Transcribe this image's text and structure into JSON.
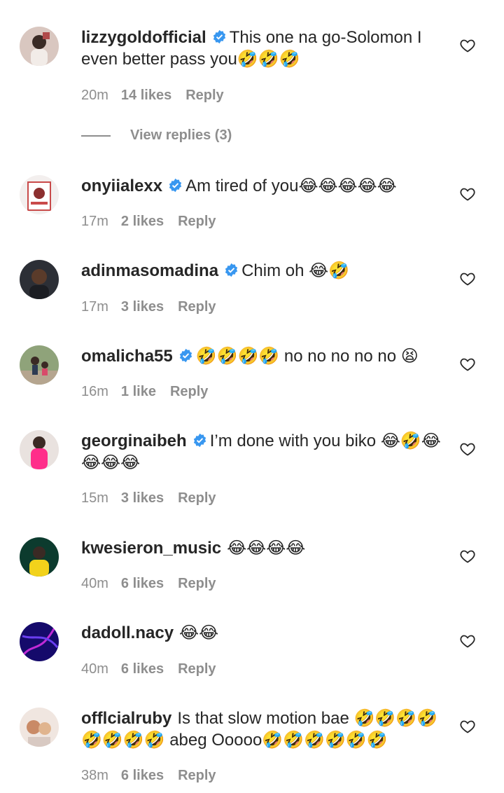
{
  "view_replies_label": "View replies (3)",
  "colors": {
    "accent": "#3897f0",
    "muted": "#8e8e8e",
    "text": "#262626"
  },
  "comments": [
    {
      "username": "lizzygoldofficial",
      "verified": true,
      "text": "This one na go-Solomon I even better pass you🤣🤣🤣",
      "time": "20m",
      "likes": "14 likes",
      "reply": "Reply"
    },
    {
      "username": "onyiialexx",
      "verified": true,
      "text": "Am tired of you😂😂😂😂😂",
      "time": "17m",
      "likes": "2 likes",
      "reply": "Reply"
    },
    {
      "username": "adinmasomadina",
      "verified": true,
      "text": "Chim oh 😂🤣",
      "time": "17m",
      "likes": "3 likes",
      "reply": "Reply"
    },
    {
      "username": "omalicha55",
      "verified": true,
      "text": "🤣🤣🤣🤣 no no no no no 😫",
      "time": "16m",
      "likes": "1 like",
      "reply": "Reply"
    },
    {
      "username": "georginaibeh",
      "verified": true,
      "text": "I’m done with you biko 😂🤣😂😂😂😂",
      "time": "15m",
      "likes": "3 likes",
      "reply": "Reply"
    },
    {
      "username": "kwesieron_music",
      "verified": false,
      "text": "😂😂😂😂",
      "time": "40m",
      "likes": "6 likes",
      "reply": "Reply"
    },
    {
      "username": "dadoll.nacy",
      "verified": false,
      "text": "😂😂",
      "time": "40m",
      "likes": "6 likes",
      "reply": "Reply"
    },
    {
      "username": "offlcialruby",
      "verified": false,
      "text": "Is that slow motion bae 🤣🤣🤣🤣🤣🤣🤣🤣 abeg Ooooo🤣🤣🤣🤣🤣🤣",
      "time": "38m",
      "likes": "6 likes",
      "reply": "Reply"
    }
  ]
}
